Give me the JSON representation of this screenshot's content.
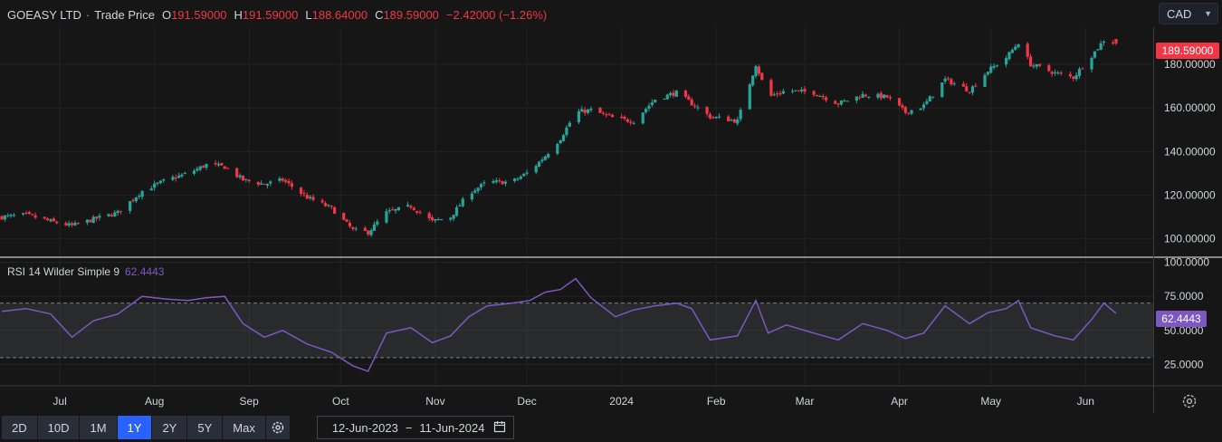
{
  "header": {
    "symbol": "GOEASY LTD",
    "separator": "·",
    "price_type": "Trade Price",
    "open_key": "O",
    "open": "191.59000",
    "high_key": "H",
    "high": "191.59000",
    "low_key": "L",
    "low": "188.64000",
    "close_key": "C",
    "close": "189.59000",
    "change": "−2.42000 (−1.26%)"
  },
  "currency": {
    "selected": "CAD",
    "icon": "chevron-down-icon"
  },
  "last_price_tag": "189.59000",
  "rsi": {
    "label": "RSI 14 Wilder Simple 9",
    "value": "62.4443"
  },
  "colors": {
    "up": "#26a69a",
    "down": "#f23645",
    "rsi_line": "#7e57c2",
    "active": "#2962ff"
  },
  "toolbar": {
    "ranges": [
      "2D",
      "10D",
      "1M",
      "1Y",
      "2Y",
      "5Y",
      "Max"
    ],
    "active_range": "1Y",
    "date_from": "12-Jun-2023",
    "date_to": "11-Jun-2024",
    "date_sep": "−",
    "icons": [
      "gear-icon",
      "calendar-icon",
      "settings-icon"
    ]
  },
  "chart_data": [
    {
      "type": "candlestick",
      "title": "GOEASY LTD · Trade Price",
      "y_ticks": [
        100,
        120,
        140,
        160,
        180
      ],
      "y_tick_labels": [
        "100.00000",
        "120.00000",
        "140.00000",
        "160.00000",
        "180.00000"
      ],
      "ylim": [
        92,
        197
      ],
      "x_tick_labels": [
        "Jul",
        "Aug",
        "Sep",
        "Oct",
        "Nov",
        "Dec",
        "2024",
        "Feb",
        "Mar",
        "Apr",
        "May",
        "Jun"
      ],
      "x_tick_dates": [
        "2023-07-01",
        "2023-08-01",
        "2023-09-01",
        "2023-10-01",
        "2023-11-01",
        "2023-12-01",
        "2024-01-01",
        "2024-02-01",
        "2024-03-01",
        "2024-04-01",
        "2024-05-01",
        "2024-06-01"
      ],
      "x_range": [
        "2023-06-12",
        "2024-06-11"
      ],
      "close_path": [
        [
          "2023-06-12",
          110
        ],
        [
          "2023-06-20",
          111
        ],
        [
          "2023-06-28",
          108
        ],
        [
          "2023-07-05",
          106
        ],
        [
          "2023-07-12",
          109
        ],
        [
          "2023-07-20",
          112
        ],
        [
          "2023-07-28",
          122
        ],
        [
          "2023-08-05",
          127
        ],
        [
          "2023-08-12",
          130
        ],
        [
          "2023-08-18",
          134
        ],
        [
          "2023-08-24",
          133
        ],
        [
          "2023-08-30",
          127
        ],
        [
          "2023-09-06",
          125
        ],
        [
          "2023-09-12",
          127
        ],
        [
          "2023-09-20",
          119
        ],
        [
          "2023-09-28",
          114
        ],
        [
          "2023-10-05",
          104
        ],
        [
          "2023-10-10",
          103
        ],
        [
          "2023-10-16",
          112
        ],
        [
          "2023-10-24",
          115
        ],
        [
          "2023-10-31",
          108
        ],
        [
          "2023-11-06",
          110
        ],
        [
          "2023-11-12",
          121
        ],
        [
          "2023-11-18",
          126
        ],
        [
          "2023-11-26",
          126
        ],
        [
          "2023-12-02",
          131
        ],
        [
          "2023-12-07",
          138
        ],
        [
          "2023-12-12",
          146
        ],
        [
          "2023-12-17",
          158
        ],
        [
          "2023-12-22",
          159
        ],
        [
          "2023-12-30",
          155
        ],
        [
          "2024-01-05",
          154
        ],
        [
          "2024-01-12",
          164
        ],
        [
          "2024-01-19",
          167
        ],
        [
          "2024-01-24",
          162
        ],
        [
          "2024-01-30",
          156
        ],
        [
          "2024-02-08",
          154
        ],
        [
          "2024-02-14",
          180
        ],
        [
          "2024-02-18",
          165
        ],
        [
          "2024-02-24",
          168
        ],
        [
          "2024-03-04",
          167
        ],
        [
          "2024-03-12",
          162
        ],
        [
          "2024-03-20",
          166
        ],
        [
          "2024-03-28",
          165
        ],
        [
          "2024-04-03",
          158
        ],
        [
          "2024-04-09",
          161
        ],
        [
          "2024-04-16",
          173
        ],
        [
          "2024-04-24",
          168
        ],
        [
          "2024-04-30",
          177
        ],
        [
          "2024-05-06",
          183
        ],
        [
          "2024-05-10",
          190
        ],
        [
          "2024-05-14",
          180
        ],
        [
          "2024-05-22",
          176
        ],
        [
          "2024-05-28",
          174
        ],
        [
          "2024-06-03",
          184
        ],
        [
          "2024-06-07",
          191
        ],
        [
          "2024-06-11",
          189.59
        ]
      ],
      "last": {
        "open": 191.59,
        "high": 191.59,
        "low": 188.64,
        "close": 189.59
      }
    },
    {
      "type": "line",
      "title": "RSI 14 Wilder Simple 9",
      "y_ticks": [
        25,
        50,
        75,
        100
      ],
      "y_tick_labels": [
        "25.0000",
        "50.0000",
        "75.0000",
        "100.0000"
      ],
      "ylim": [
        10,
        103
      ],
      "band": [
        30,
        70
      ],
      "x": [
        "2023-06-12",
        "2023-06-20",
        "2023-06-28",
        "2023-07-05",
        "2023-07-12",
        "2023-07-20",
        "2023-07-28",
        "2023-08-05",
        "2023-08-12",
        "2023-08-18",
        "2023-08-24",
        "2023-08-30",
        "2023-09-06",
        "2023-09-12",
        "2023-09-20",
        "2023-09-28",
        "2023-10-05",
        "2023-10-10",
        "2023-10-16",
        "2023-10-24",
        "2023-10-31",
        "2023-11-06",
        "2023-11-12",
        "2023-11-18",
        "2023-11-26",
        "2023-12-02",
        "2023-12-07",
        "2023-12-12",
        "2023-12-17",
        "2023-12-22",
        "2023-12-30",
        "2024-01-05",
        "2024-01-12",
        "2024-01-19",
        "2024-01-24",
        "2024-01-30",
        "2024-02-08",
        "2024-02-14",
        "2024-02-18",
        "2024-02-24",
        "2024-03-04",
        "2024-03-12",
        "2024-03-20",
        "2024-03-28",
        "2024-04-03",
        "2024-04-09",
        "2024-04-16",
        "2024-04-24",
        "2024-04-30",
        "2024-05-06",
        "2024-05-10",
        "2024-05-14",
        "2024-05-22",
        "2024-05-28",
        "2024-06-03",
        "2024-06-07",
        "2024-06-11"
      ],
      "values": [
        64,
        66,
        62,
        45,
        57,
        62,
        75,
        73,
        72,
        74,
        75,
        55,
        45,
        50,
        40,
        34,
        24,
        20,
        48,
        52,
        41,
        46,
        60,
        68,
        70,
        72,
        78,
        80,
        88,
        74,
        60,
        65,
        68,
        70,
        66,
        43,
        46,
        72,
        48,
        54,
        48,
        43,
        55,
        50,
        44,
        48,
        68,
        55,
        63,
        66,
        72,
        52,
        46,
        43,
        58,
        70,
        62.44
      ]
    }
  ]
}
